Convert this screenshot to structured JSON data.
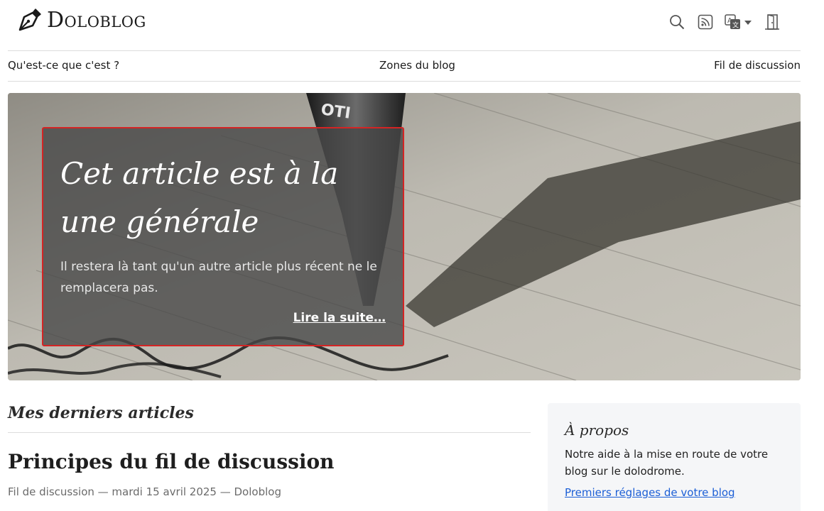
{
  "header": {
    "brand": "Doloblog",
    "icons": [
      "search-icon",
      "rss-icon",
      "translate-icon",
      "chevron-down-icon",
      "door-icon"
    ]
  },
  "nav": {
    "items": [
      {
        "label": "Qu'est-ce que c'est ?"
      },
      {
        "label": "Zones du blog"
      },
      {
        "label": "Fil de discussion"
      }
    ]
  },
  "hero": {
    "title": "Cet article est à la une générale",
    "subtitle": "Il restera là tant qu'un autre article plus récent ne le remplacera pas.",
    "more": "Lire la suite…"
  },
  "main": {
    "section_title": "Mes derniers articles",
    "post": {
      "title": "Principes du fil de discussion",
      "meta": "Fil de discussion — mardi 15 avril 2025 — Doloblog"
    }
  },
  "sidebar": {
    "title": "À propos",
    "text": "Notre aide à la mise en route de votre blog sur le dolodrome.",
    "link": "Premiers réglages de votre blog"
  },
  "colors": {
    "card_border": "#d42424",
    "link": "#1c5fd6",
    "sidebar_bg": "#f5f6f8"
  }
}
